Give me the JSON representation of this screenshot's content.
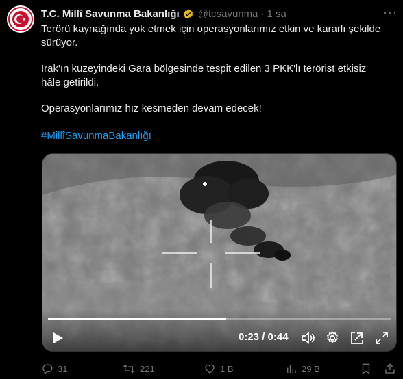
{
  "account": {
    "name": "T.C. Millî Savunma Bakanlığı",
    "handle": "@tcsavunma",
    "separator": "·",
    "time": "1 sa"
  },
  "tweet": {
    "line1": "Terörü kaynağında yok etmek için operasyonlarımız etkin ve kararlı şekilde",
    "line2": "sürüyor.",
    "line3": "Irak'ın kuzeyindeki Gara bölgesinde tespit edilen 3 PKK'lı terörist etkisiz",
    "line4": "hâle getirildi.",
    "line5": "Operasyonlarımız hız kesmeden devam edecek!",
    "hashtag": "#MillîSavunmaBakanlığı"
  },
  "video": {
    "timecode": "0:23 / 0:44",
    "progress": 0.52,
    "icons": [
      "play-icon",
      "volume-icon",
      "settings-icon",
      "pip-icon",
      "fullscreen-icon"
    ]
  },
  "actions": {
    "replies": "31",
    "retweets": "221",
    "likes": "1 B",
    "views": "29 B"
  },
  "colors": {
    "background": "#000000",
    "text": "#e7e9ea",
    "muted": "#71767b",
    "link": "#1d9bf0",
    "verified": "#e2b719"
  }
}
